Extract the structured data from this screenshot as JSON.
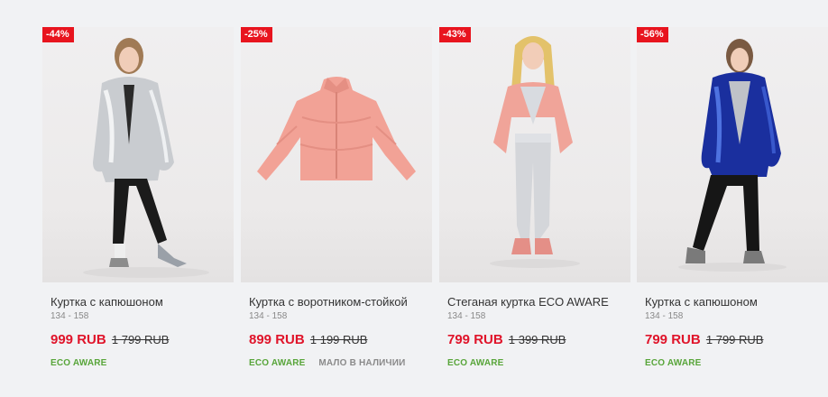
{
  "products": [
    {
      "discount": "-44%",
      "name": "Куртка с капюшоном",
      "sizes": "134 - 158",
      "price": "999 RUB",
      "old_price": "1 799 RUB",
      "tags": [
        "ECO AWARE"
      ]
    },
    {
      "discount": "-25%",
      "name": "Куртка с воротником-стойкой",
      "sizes": "134 - 158",
      "price": "899 RUB",
      "old_price": "1 199 RUB",
      "tags": [
        "ECO AWARE",
        "МАЛО В НАЛИЧИИ"
      ]
    },
    {
      "discount": "-43%",
      "name": "Стеганая куртка ECO AWARE",
      "sizes": "134 - 158",
      "price": "799 RUB",
      "old_price": "1 399 RUB",
      "tags": [
        "ECO AWARE"
      ]
    },
    {
      "discount": "-56%",
      "name": "Куртка с капюшоном",
      "sizes": "134 - 158",
      "price": "799 RUB",
      "old_price": "1 799 RUB",
      "tags": [
        "ECO AWARE"
      ]
    }
  ],
  "colors": {
    "badge": "#e8141e",
    "price": "#e0142a",
    "eco": "#58a53a"
  }
}
